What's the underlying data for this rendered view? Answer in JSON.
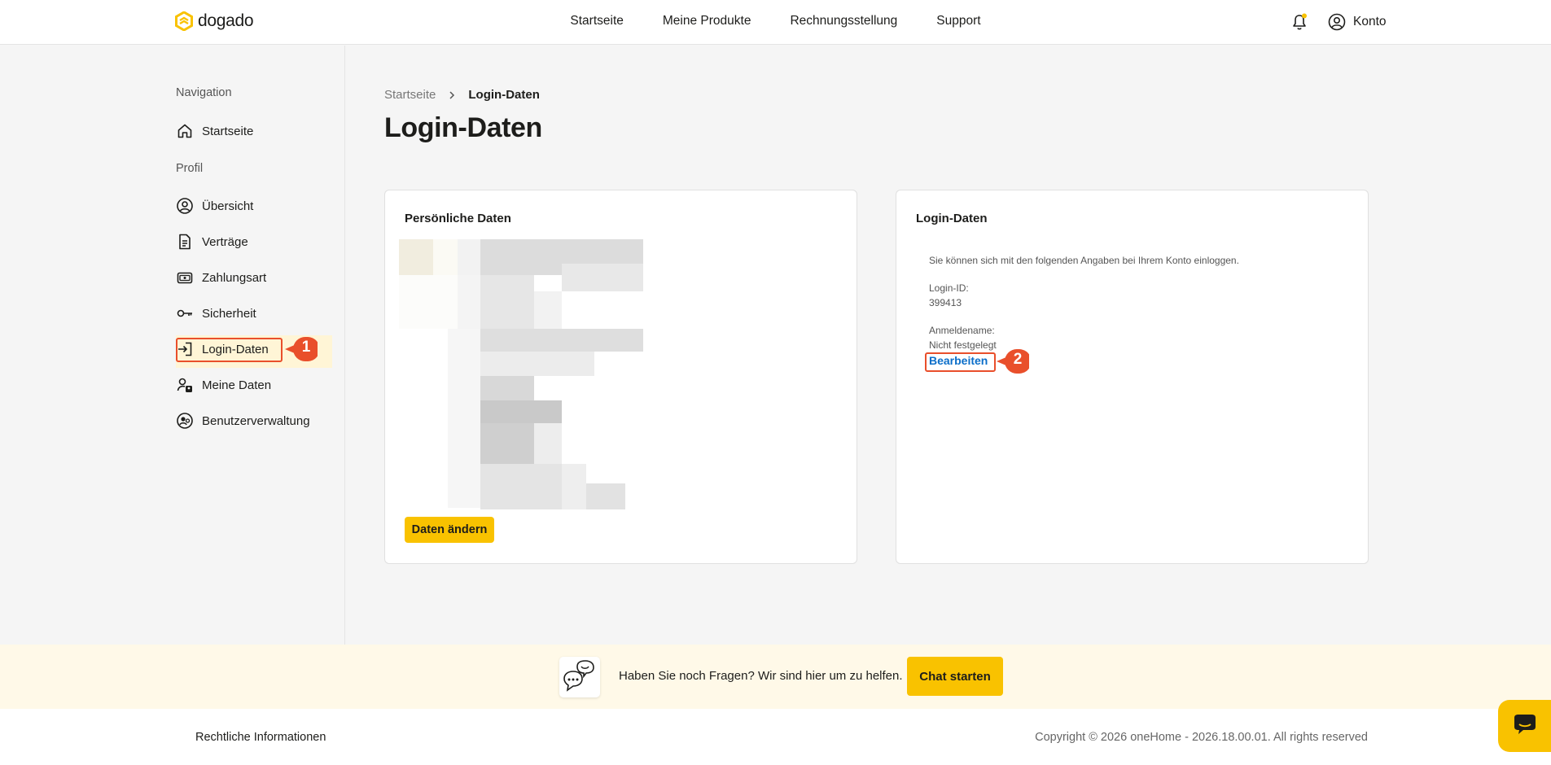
{
  "header": {
    "logo_text": "dogado",
    "nav": [
      "Startseite",
      "Meine Produkte",
      "Rechnungsstellung",
      "Support"
    ],
    "account_label": "Konto",
    "accent": "#f9c200"
  },
  "sidebar": {
    "heading_nav": "Navigation",
    "item_home": "Startseite",
    "heading_profile": "Profil",
    "items": [
      {
        "label": "Übersicht",
        "icon": "user-circle-icon"
      },
      {
        "label": "Verträge",
        "icon": "document-icon"
      },
      {
        "label": "Zahlungsart",
        "icon": "wallet-icon"
      },
      {
        "label": "Sicherheit",
        "icon": "key-icon"
      },
      {
        "label": "Login-Daten",
        "icon": "login-icon"
      },
      {
        "label": "Meine Daten",
        "icon": "user-settings-icon"
      },
      {
        "label": "Benutzerverwaltung",
        "icon": "users-icon"
      }
    ],
    "active": "Login-Daten"
  },
  "annotations": {
    "one": "1",
    "two": "2"
  },
  "main": {
    "breadcrumb": {
      "home": "Startseite",
      "current": "Login-Daten"
    },
    "title": "Login-Daten",
    "personal_card": {
      "title": "Persönliche Daten",
      "button": "Daten ändern"
    },
    "login_card": {
      "title": "Login-Daten",
      "intro": "Sie können sich mit den folgenden Angaben bei Ihrem Konto einloggen.",
      "login_id_label": "Login-ID:",
      "login_id_value": "399413",
      "username_label": "Anmeldename:",
      "username_value": "Nicht festgelegt",
      "edit_link": "Bearbeiten"
    }
  },
  "help": {
    "text": "Haben Sie noch Fragen? Wir sind hier um zu helfen.",
    "button": "Chat starten"
  },
  "footer": {
    "legal": "Rechtliche Informationen",
    "copyright": "Copyright © 2026 oneHome - 2026.18.00.01. All rights reserved"
  }
}
